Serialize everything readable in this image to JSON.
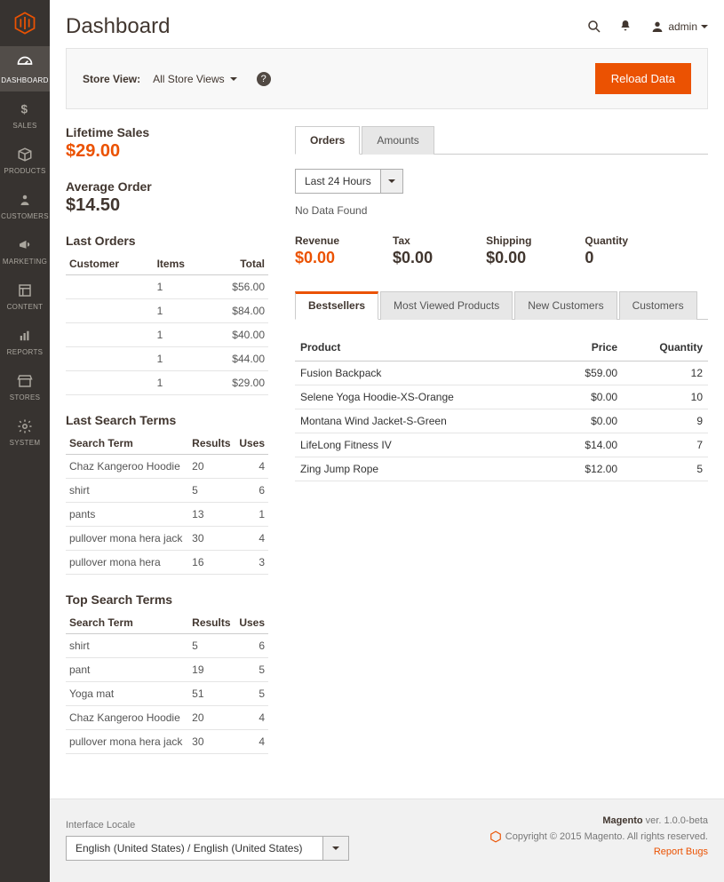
{
  "header": {
    "title": "Dashboard",
    "admin_label": "admin"
  },
  "sidebar": {
    "items": [
      {
        "label": "DASHBOARD"
      },
      {
        "label": "SALES"
      },
      {
        "label": "PRODUCTS"
      },
      {
        "label": "CUSTOMERS"
      },
      {
        "label": "MARKETING"
      },
      {
        "label": "CONTENT"
      },
      {
        "label": "REPORTS"
      },
      {
        "label": "STORES"
      },
      {
        "label": "SYSTEM"
      }
    ]
  },
  "storebar": {
    "label": "Store View:",
    "value": "All Store Views",
    "reload_label": "Reload Data"
  },
  "stats": {
    "lifetime_label": "Lifetime Sales",
    "lifetime_value": "$29.00",
    "average_label": "Average Order",
    "average_value": "$14.50"
  },
  "last_orders": {
    "heading": "Last Orders",
    "cols": {
      "customer": "Customer",
      "items": "Items",
      "total": "Total"
    },
    "rows": [
      {
        "customer": "",
        "items": "1",
        "total": "$56.00"
      },
      {
        "customer": "",
        "items": "1",
        "total": "$84.00"
      },
      {
        "customer": "",
        "items": "1",
        "total": "$40.00"
      },
      {
        "customer": "",
        "items": "1",
        "total": "$44.00"
      },
      {
        "customer": "",
        "items": "1",
        "total": "$29.00"
      }
    ]
  },
  "last_search": {
    "heading": "Last Search Terms",
    "cols": {
      "term": "Search Term",
      "results": "Results",
      "uses": "Uses"
    },
    "rows": [
      {
        "term": "Chaz Kangeroo Hoodie",
        "results": "20",
        "uses": "4"
      },
      {
        "term": "shirt",
        "results": "5",
        "uses": "6"
      },
      {
        "term": "pants",
        "results": "13",
        "uses": "1"
      },
      {
        "term": "pullover mona hera jack",
        "results": "30",
        "uses": "4"
      },
      {
        "term": "pullover mona hera",
        "results": "16",
        "uses": "3"
      }
    ]
  },
  "top_search": {
    "heading": "Top Search Terms",
    "cols": {
      "term": "Search Term",
      "results": "Results",
      "uses": "Uses"
    },
    "rows": [
      {
        "term": "shirt",
        "results": "5",
        "uses": "6"
      },
      {
        "term": "pant",
        "results": "19",
        "uses": "5"
      },
      {
        "term": "Yoga mat",
        "results": "51",
        "uses": "5"
      },
      {
        "term": "Chaz Kangeroo Hoodie",
        "results": "20",
        "uses": "4"
      },
      {
        "term": "pullover mona hera jack",
        "results": "30",
        "uses": "4"
      }
    ]
  },
  "main_tabs": {
    "orders": "Orders",
    "amounts": "Amounts"
  },
  "period": {
    "value": "Last 24 Hours",
    "no_data": "No Data Found"
  },
  "metrics": {
    "revenue_label": "Revenue",
    "revenue_value": "$0.00",
    "tax_label": "Tax",
    "tax_value": "$0.00",
    "shipping_label": "Shipping",
    "shipping_value": "$0.00",
    "quantity_label": "Quantity",
    "quantity_value": "0"
  },
  "sub_tabs": {
    "bestsellers": "Bestsellers",
    "most_viewed": "Most Viewed Products",
    "new_customers": "New Customers",
    "customers": "Customers"
  },
  "bestsellers": {
    "cols": {
      "product": "Product",
      "price": "Price",
      "quantity": "Quantity"
    },
    "rows": [
      {
        "product": "Fusion Backpack",
        "price": "$59.00",
        "quantity": "12"
      },
      {
        "product": "Selene Yoga Hoodie-XS-Orange",
        "price": "$0.00",
        "quantity": "10"
      },
      {
        "product": "Montana Wind Jacket-S-Green",
        "price": "$0.00",
        "quantity": "9"
      },
      {
        "product": "LifeLong Fitness IV",
        "price": "$14.00",
        "quantity": "7"
      },
      {
        "product": "Zing Jump Rope",
        "price": "$12.00",
        "quantity": "5"
      }
    ]
  },
  "footer": {
    "locale_label": "Interface Locale",
    "locale_value": "English (United States) / English (United States)",
    "brand": "Magento",
    "version": " ver. 1.0.0-beta",
    "copyright": "Copyright © 2015 Magento. All rights reserved.",
    "report_bugs": "Report Bugs"
  }
}
